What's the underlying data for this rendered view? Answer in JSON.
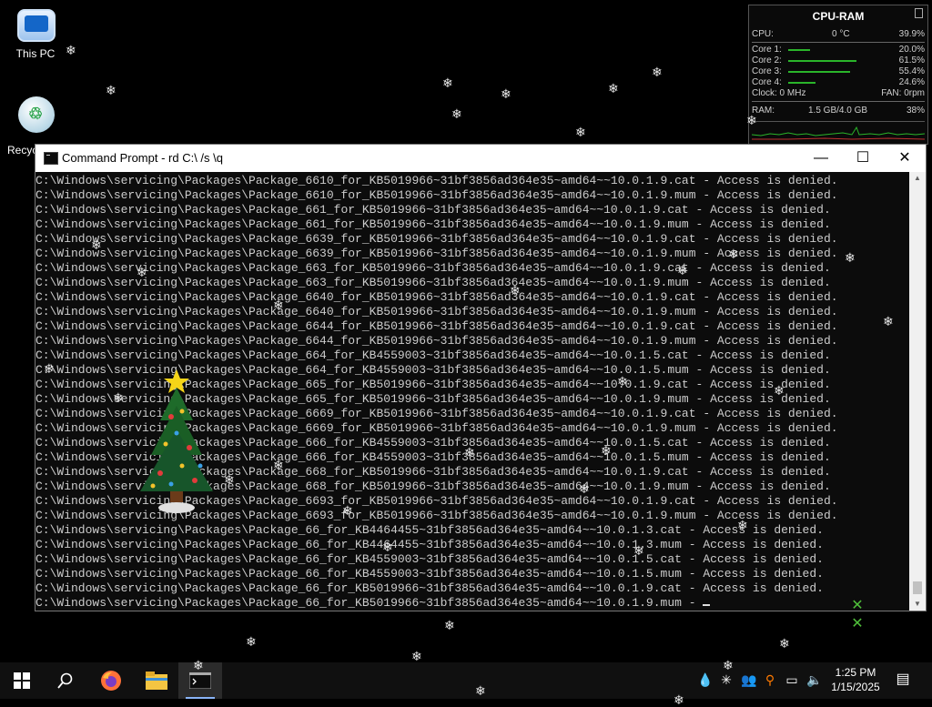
{
  "desktop": {
    "icons": [
      {
        "label": "This PC",
        "icon": "this-pc-icon"
      },
      {
        "label": "Recyc",
        "icon": "recycle-bin-icon"
      }
    ]
  },
  "widget": {
    "title": "CPU-RAM",
    "cpu_label": "CPU:",
    "cpu_temp": "0 °C",
    "cpu_percent": "39.9%",
    "cores": [
      {
        "label": "Core 1:",
        "value": "20.0%",
        "level": 0.2
      },
      {
        "label": "Core 2:",
        "value": "61.5%",
        "level": 0.615
      },
      {
        "label": "Core 3:",
        "value": "55.4%",
        "level": 0.554
      },
      {
        "label": "Core 4:",
        "value": "24.6%",
        "level": 0.246
      }
    ],
    "clock": "Clock: 0 MHz",
    "fan": "FAN: 0rpm",
    "ram_label": "RAM:",
    "ram_usage": "1.5 GB/4.0 GB",
    "ram_percent": "38%"
  },
  "window": {
    "title": "Command Prompt - rd  C:\\ /s \\q",
    "buttons": {
      "minimize": "—",
      "maximize": "☐",
      "close": "✕"
    },
    "lines": [
      "C:\\Windows\\servicing\\Packages\\Package_6610_for_KB5019966~31bf3856ad364e35~amd64~~10.0.1.9.cat - Access is denied.",
      "C:\\Windows\\servicing\\Packages\\Package_6610_for_KB5019966~31bf3856ad364e35~amd64~~10.0.1.9.mum - Access is denied.",
      "C:\\Windows\\servicing\\Packages\\Package_661_for_KB5019966~31bf3856ad364e35~amd64~~10.0.1.9.cat - Access is denied.",
      "C:\\Windows\\servicing\\Packages\\Package_661_for_KB5019966~31bf3856ad364e35~amd64~~10.0.1.9.mum - Access is denied.",
      "C:\\Windows\\servicing\\Packages\\Package_6639_for_KB5019966~31bf3856ad364e35~amd64~~10.0.1.9.cat - Access is denied.",
      "C:\\Windows\\servicing\\Packages\\Package_6639_for_KB5019966~31bf3856ad364e35~amd64~~10.0.1.9.mum - Access is denied.",
      "C:\\Windows\\servicing\\Packages\\Package_663_for_KB5019966~31bf3856ad364e35~amd64~~10.0.1.9.cat - Access is denied.",
      "C:\\Windows\\servicing\\Packages\\Package_663_for_KB5019966~31bf3856ad364e35~amd64~~10.0.1.9.mum - Access is denied.",
      "C:\\Windows\\servicing\\Packages\\Package_6640_for_KB5019966~31bf3856ad364e35~amd64~~10.0.1.9.cat - Access is denied.",
      "C:\\Windows\\servicing\\Packages\\Package_6640_for_KB5019966~31bf3856ad364e35~amd64~~10.0.1.9.mum - Access is denied.",
      "C:\\Windows\\servicing\\Packages\\Package_6644_for_KB5019966~31bf3856ad364e35~amd64~~10.0.1.9.cat - Access is denied.",
      "C:\\Windows\\servicing\\Packages\\Package_6644_for_KB5019966~31bf3856ad364e35~amd64~~10.0.1.9.mum - Access is denied.",
      "C:\\Windows\\servicing\\Packages\\Package_664_for_KB4559003~31bf3856ad364e35~amd64~~10.0.1.5.cat - Access is denied.",
      "C:\\Windows\\servicing\\Packages\\Package_664_for_KB4559003~31bf3856ad364e35~amd64~~10.0.1.5.mum - Access is denied.",
      "C:\\Windows\\servicing\\Packages\\Package_665_for_KB5019966~31bf3856ad364e35~amd64~~10.0.1.9.cat - Access is denied.",
      "C:\\Windows\\servicing\\Packages\\Package_665_for_KB5019966~31bf3856ad364e35~amd64~~10.0.1.9.mum - Access is denied.",
      "C:\\Windows\\servicing\\Packages\\Package_6669_for_KB5019966~31bf3856ad364e35~amd64~~10.0.1.9.cat - Access is denied.",
      "C:\\Windows\\servicing\\Packages\\Package_6669_for_KB5019966~31bf3856ad364e35~amd64~~10.0.1.9.mum - Access is denied.",
      "C:\\Windows\\servicing\\Packages\\Package_666_for_KB4559003~31bf3856ad364e35~amd64~~10.0.1.5.cat - Access is denied.",
      "C:\\Windows\\servicing\\Packages\\Package_666_for_KB4559003~31bf3856ad364e35~amd64~~10.0.1.5.mum - Access is denied.",
      "C:\\Windows\\servicing\\Packages\\Package_668_for_KB5019966~31bf3856ad364e35~amd64~~10.0.1.9.cat - Access is denied.",
      "C:\\Windows\\servicing\\Packages\\Package_668_for_KB5019966~31bf3856ad364e35~amd64~~10.0.1.9.mum - Access is denied.",
      "C:\\Windows\\servicing\\Packages\\Package_6693_for_KB5019966~31bf3856ad364e35~amd64~~10.0.1.9.cat - Access is denied.",
      "C:\\Windows\\servicing\\Packages\\Package_6693_for_KB5019966~31bf3856ad364e35~amd64~~10.0.1.9.mum - Access is denied.",
      "C:\\Windows\\servicing\\Packages\\Package_66_for_KB4464455~31bf3856ad364e35~amd64~~10.0.1.3.cat - Access is denied.",
      "C:\\Windows\\servicing\\Packages\\Package_66_for_KB4464455~31bf3856ad364e35~amd64~~10.0.1.3.mum - Access is denied.",
      "C:\\Windows\\servicing\\Packages\\Package_66_for_KB4559003~31bf3856ad364e35~amd64~~10.0.1.5.cat - Access is denied.",
      "C:\\Windows\\servicing\\Packages\\Package_66_for_KB4559003~31bf3856ad364e35~amd64~~10.0.1.5.mum - Access is denied.",
      "C:\\Windows\\servicing\\Packages\\Package_66_for_KB5019966~31bf3856ad364e35~amd64~~10.0.1.9.cat - Access is denied.",
      "C:\\Windows\\servicing\\Packages\\Package_66_for_KB5019966~31bf3856ad364e35~amd64~~10.0.1.9.mum - "
    ]
  },
  "taskbar": {
    "items": [
      "start-icon",
      "search-icon",
      "firefox-icon",
      "file-explorer-icon",
      "command-prompt-icon"
    ],
    "time": "1:25 PM",
    "date": "1/15/2025",
    "tray_icons": [
      "water-drop-icon",
      "snowflake-icon",
      "people-icon",
      "search-tray-icon",
      "network-icon",
      "volume-icon",
      "notifications-icon"
    ]
  },
  "colors": {
    "console_text": "#cccccc",
    "widget_bar": "#2ab52a",
    "accent": "#8ab4f8"
  }
}
